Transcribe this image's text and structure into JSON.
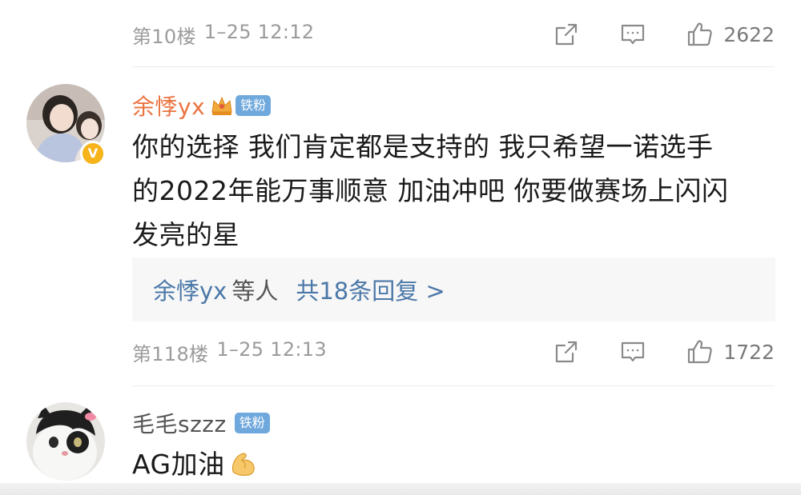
{
  "top_meta": {
    "floor": "第10楼",
    "time": "1–25 12:12",
    "like_count": "2622"
  },
  "comment1": {
    "user": "余悸yx",
    "fan_badge": "铁粉",
    "verified": "V",
    "text_lines": [
      "你的选择 我们肯定都是支持的 我只希望一诺选手",
      "的2022年能万事顺意 加油冲吧 你要做赛场上闪闪",
      "发亮的星"
    ],
    "reply_users": "余悸yx",
    "reply_suffix": "等人",
    "reply_count": "共18条回复 >",
    "floor": "第118楼",
    "time": "1–25 12:13",
    "like_count": "1722"
  },
  "comment2": {
    "user": "毛毛szzz",
    "fan_badge": "铁粉",
    "text": "AG加油"
  },
  "icons": {
    "share": "share-icon",
    "comment": "comment-icon",
    "like": "thumbs-up-icon",
    "crown": "crown-icon",
    "flex": "flexed-biceps-icon"
  },
  "colors": {
    "username_orange": "#eb7340",
    "reply_link_blue": "#4b78a8",
    "fan_badge_blue": "#6fa8dc",
    "meta_gray": "#9b9b9b"
  }
}
